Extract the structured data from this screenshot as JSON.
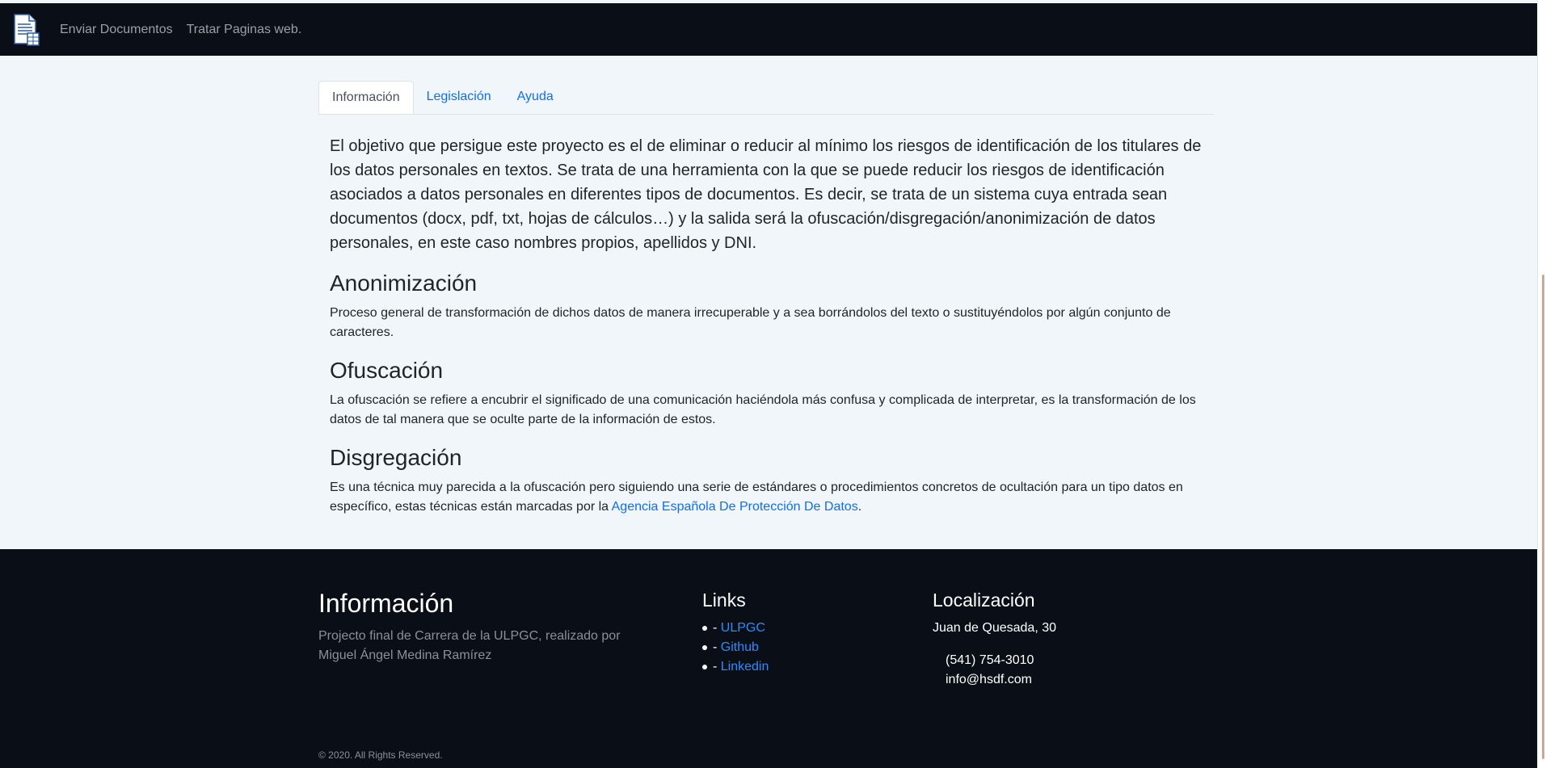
{
  "navbar": {
    "logo_icon": "document-icon",
    "links": [
      "Enviar Documentos",
      "Tratar Paginas web."
    ]
  },
  "tabs": [
    {
      "label": "Información",
      "active": true
    },
    {
      "label": "Legislación",
      "active": false
    },
    {
      "label": "Ayuda",
      "active": false
    }
  ],
  "content": {
    "lead": "El objetivo que persigue este proyecto es el de eliminar o reducir al mínimo los riesgos de identificación de los titulares de los datos personales en textos. Se trata de una herramienta con la que se puede reducir los riesgos de identificación asociados a datos personales en diferentes tipos de documentos. Es decir, se trata de un sistema cuya entrada sean documentos (docx, pdf, txt, hojas de cálculos…) y la salida será la ofuscación/disgregación/anonimización de datos personales, en este caso nombres propios, apellidos y DNI.",
    "sections": [
      {
        "heading": "Anonimización",
        "text": "Proceso general de transformación de dichos datos de manera irrecuperable y a sea borrándolos del texto o sustituyéndolos por algún conjunto de caracteres."
      },
      {
        "heading": "Ofuscación",
        "text": "La ofuscación se refiere a encubrir el significado de una comunicación haciéndola más confusa y complicada de interpretar, es la transformación de los datos de tal manera que se oculte parte de la información de estos."
      },
      {
        "heading": "Disgregación",
        "text": "Es una técnica muy parecida a la ofuscación pero siguiendo una serie de estándares o procedimientos concretos de ocultación para un tipo datos en específico, estas técnicas están marcadas por la ",
        "link": "Agencia Española De Protección De Datos",
        "suffix": "."
      }
    ]
  },
  "footer": {
    "info_title": "Información",
    "info_text": "Projecto final de Carrera de la ULPGC, realizado por Miguel Ángel Medina Ramírez",
    "links_title": "Links",
    "link_prefix": "- ",
    "links": [
      "ULPGC",
      "Github",
      "Linkedin"
    ],
    "location_title": "Localización",
    "address": "Juan de Quesada, 30",
    "phone": "(541) 754-3010",
    "email": "info@hsdf.com",
    "copyright": "© 2020. All Rights Reserved."
  },
  "colors": {
    "navbar_bg": "#0a0f17",
    "page_bg": "#f0f6fa",
    "link": "#0d6efd"
  }
}
